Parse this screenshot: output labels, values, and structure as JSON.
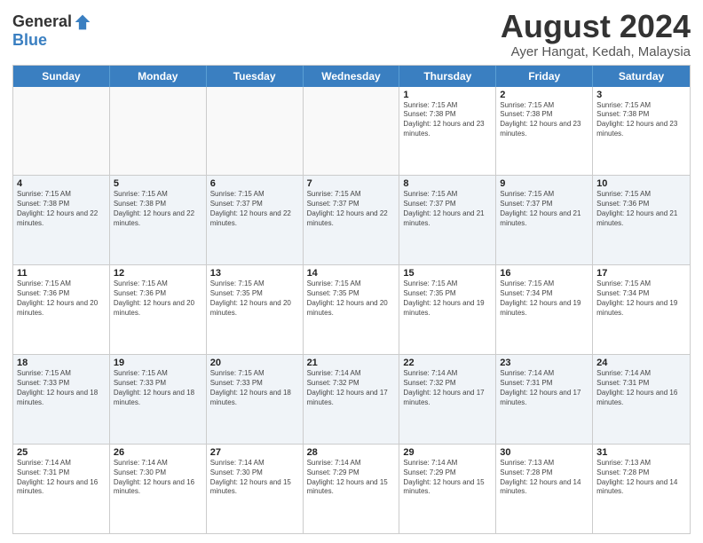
{
  "logo": {
    "general": "General",
    "blue": "Blue"
  },
  "title": {
    "month_year": "August 2024",
    "location": "Ayer Hangat, Kedah, Malaysia"
  },
  "header_days": [
    "Sunday",
    "Monday",
    "Tuesday",
    "Wednesday",
    "Thursday",
    "Friday",
    "Saturday"
  ],
  "rows": [
    [
      {
        "day": "",
        "sunrise": "",
        "sunset": "",
        "daylight": "",
        "empty": true
      },
      {
        "day": "",
        "sunrise": "",
        "sunset": "",
        "daylight": "",
        "empty": true
      },
      {
        "day": "",
        "sunrise": "",
        "sunset": "",
        "daylight": "",
        "empty": true
      },
      {
        "day": "",
        "sunrise": "",
        "sunset": "",
        "daylight": "",
        "empty": true
      },
      {
        "day": "1",
        "sunrise": "Sunrise: 7:15 AM",
        "sunset": "Sunset: 7:38 PM",
        "daylight": "Daylight: 12 hours and 23 minutes."
      },
      {
        "day": "2",
        "sunrise": "Sunrise: 7:15 AM",
        "sunset": "Sunset: 7:38 PM",
        "daylight": "Daylight: 12 hours and 23 minutes."
      },
      {
        "day": "3",
        "sunrise": "Sunrise: 7:15 AM",
        "sunset": "Sunset: 7:38 PM",
        "daylight": "Daylight: 12 hours and 23 minutes."
      }
    ],
    [
      {
        "day": "4",
        "sunrise": "Sunrise: 7:15 AM",
        "sunset": "Sunset: 7:38 PM",
        "daylight": "Daylight: 12 hours and 22 minutes."
      },
      {
        "day": "5",
        "sunrise": "Sunrise: 7:15 AM",
        "sunset": "Sunset: 7:38 PM",
        "daylight": "Daylight: 12 hours and 22 minutes."
      },
      {
        "day": "6",
        "sunrise": "Sunrise: 7:15 AM",
        "sunset": "Sunset: 7:37 PM",
        "daylight": "Daylight: 12 hours and 22 minutes."
      },
      {
        "day": "7",
        "sunrise": "Sunrise: 7:15 AM",
        "sunset": "Sunset: 7:37 PM",
        "daylight": "Daylight: 12 hours and 22 minutes."
      },
      {
        "day": "8",
        "sunrise": "Sunrise: 7:15 AM",
        "sunset": "Sunset: 7:37 PM",
        "daylight": "Daylight: 12 hours and 21 minutes."
      },
      {
        "day": "9",
        "sunrise": "Sunrise: 7:15 AM",
        "sunset": "Sunset: 7:37 PM",
        "daylight": "Daylight: 12 hours and 21 minutes."
      },
      {
        "day": "10",
        "sunrise": "Sunrise: 7:15 AM",
        "sunset": "Sunset: 7:36 PM",
        "daylight": "Daylight: 12 hours and 21 minutes."
      }
    ],
    [
      {
        "day": "11",
        "sunrise": "Sunrise: 7:15 AM",
        "sunset": "Sunset: 7:36 PM",
        "daylight": "Daylight: 12 hours and 20 minutes."
      },
      {
        "day": "12",
        "sunrise": "Sunrise: 7:15 AM",
        "sunset": "Sunset: 7:36 PM",
        "daylight": "Daylight: 12 hours and 20 minutes."
      },
      {
        "day": "13",
        "sunrise": "Sunrise: 7:15 AM",
        "sunset": "Sunset: 7:35 PM",
        "daylight": "Daylight: 12 hours and 20 minutes."
      },
      {
        "day": "14",
        "sunrise": "Sunrise: 7:15 AM",
        "sunset": "Sunset: 7:35 PM",
        "daylight": "Daylight: 12 hours and 20 minutes."
      },
      {
        "day": "15",
        "sunrise": "Sunrise: 7:15 AM",
        "sunset": "Sunset: 7:35 PM",
        "daylight": "Daylight: 12 hours and 19 minutes."
      },
      {
        "day": "16",
        "sunrise": "Sunrise: 7:15 AM",
        "sunset": "Sunset: 7:34 PM",
        "daylight": "Daylight: 12 hours and 19 minutes."
      },
      {
        "day": "17",
        "sunrise": "Sunrise: 7:15 AM",
        "sunset": "Sunset: 7:34 PM",
        "daylight": "Daylight: 12 hours and 19 minutes."
      }
    ],
    [
      {
        "day": "18",
        "sunrise": "Sunrise: 7:15 AM",
        "sunset": "Sunset: 7:33 PM",
        "daylight": "Daylight: 12 hours and 18 minutes."
      },
      {
        "day": "19",
        "sunrise": "Sunrise: 7:15 AM",
        "sunset": "Sunset: 7:33 PM",
        "daylight": "Daylight: 12 hours and 18 minutes."
      },
      {
        "day": "20",
        "sunrise": "Sunrise: 7:15 AM",
        "sunset": "Sunset: 7:33 PM",
        "daylight": "Daylight: 12 hours and 18 minutes."
      },
      {
        "day": "21",
        "sunrise": "Sunrise: 7:14 AM",
        "sunset": "Sunset: 7:32 PM",
        "daylight": "Daylight: 12 hours and 17 minutes."
      },
      {
        "day": "22",
        "sunrise": "Sunrise: 7:14 AM",
        "sunset": "Sunset: 7:32 PM",
        "daylight": "Daylight: 12 hours and 17 minutes."
      },
      {
        "day": "23",
        "sunrise": "Sunrise: 7:14 AM",
        "sunset": "Sunset: 7:31 PM",
        "daylight": "Daylight: 12 hours and 17 minutes."
      },
      {
        "day": "24",
        "sunrise": "Sunrise: 7:14 AM",
        "sunset": "Sunset: 7:31 PM",
        "daylight": "Daylight: 12 hours and 16 minutes."
      }
    ],
    [
      {
        "day": "25",
        "sunrise": "Sunrise: 7:14 AM",
        "sunset": "Sunset: 7:31 PM",
        "daylight": "Daylight: 12 hours and 16 minutes."
      },
      {
        "day": "26",
        "sunrise": "Sunrise: 7:14 AM",
        "sunset": "Sunset: 7:30 PM",
        "daylight": "Daylight: 12 hours and 16 minutes."
      },
      {
        "day": "27",
        "sunrise": "Sunrise: 7:14 AM",
        "sunset": "Sunset: 7:30 PM",
        "daylight": "Daylight: 12 hours and 15 minutes."
      },
      {
        "day": "28",
        "sunrise": "Sunrise: 7:14 AM",
        "sunset": "Sunset: 7:29 PM",
        "daylight": "Daylight: 12 hours and 15 minutes."
      },
      {
        "day": "29",
        "sunrise": "Sunrise: 7:14 AM",
        "sunset": "Sunset: 7:29 PM",
        "daylight": "Daylight: 12 hours and 15 minutes."
      },
      {
        "day": "30",
        "sunrise": "Sunrise: 7:13 AM",
        "sunset": "Sunset: 7:28 PM",
        "daylight": "Daylight: 12 hours and 14 minutes."
      },
      {
        "day": "31",
        "sunrise": "Sunrise: 7:13 AM",
        "sunset": "Sunset: 7:28 PM",
        "daylight": "Daylight: 12 hours and 14 minutes."
      }
    ]
  ]
}
